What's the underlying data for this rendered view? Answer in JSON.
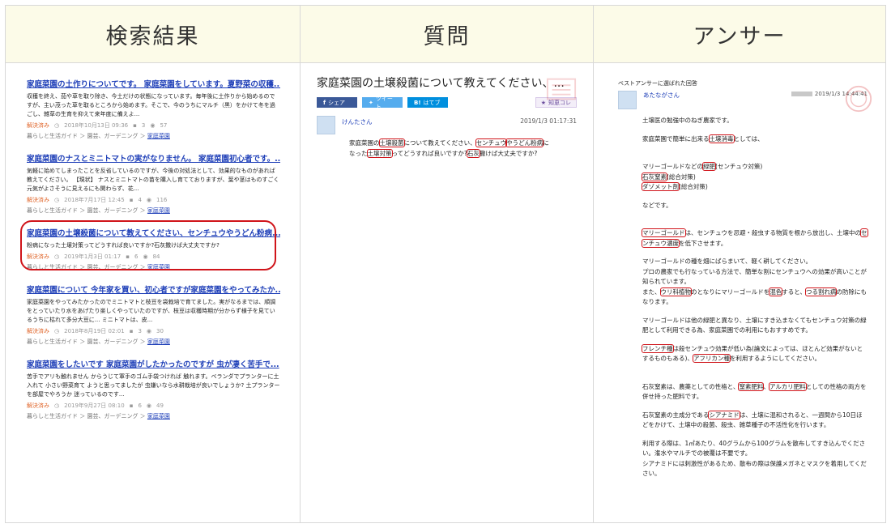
{
  "columns": {
    "search": "検索結果",
    "question": "質問",
    "answer": "アンサー"
  },
  "results": [
    {
      "title": "家庭菜園の土作りについてです。 家庭菜園をしています。夏野菜の収穫...",
      "snippet": "収穫を終え、茄や草を取り除き、今土だけの状態になっています。毎年後に土作りから始めるのですが、主い茂った草を取るところから始めます。そこで、今のうちにマルチ（黒）をかけて冬を過ごし、雑草の生育を抑えて来年度に備えよ...",
      "status": "解決済み",
      "date": "2018年10月13日 09:36",
      "answers": "3",
      "views": "57",
      "category": "暮らしと生活ガイド ＞ 園芸、ガーデニング ＞ ",
      "category_link": "家庭菜園"
    },
    {
      "title": "家庭菜園のナスとミニトマトの実がなりません。 家庭菜園初心者です。...",
      "snippet": "気軽に始めてしまったことを反省しているのですが、今後の対処法として、効果的なものがあれば教えてください。 【現状】 ナスとミニトマトの苗を購入し育てておりますが、葉や茎はものすごく元気がよさそうに見えるにも関わらず、花...",
      "status": "解決済み",
      "date": "2018年7月17日 12:45",
      "answers": "4",
      "views": "116",
      "category": "暮らしと生活ガイド ＞ 園芸、ガーデニング ＞ ",
      "category_link": "家庭菜園"
    },
    {
      "title": "家庭菜園の土壌殺菌について教えてください、センチュウやうどん粉病...",
      "snippet": "粉病になった土壌対策ってどうすれば良いですか?石灰撒けば大丈夫ですか?",
      "status": "解決済み",
      "date": "2019年1月3日 01:17",
      "answers": "6",
      "views": "84",
      "category": "暮らしと生活ガイド ＞ 園芸、ガーデニング ＞ ",
      "category_link": "家庭菜園"
    },
    {
      "title": "家庭菜園について 今年家を買い、初心者ですが家庭菜園をやってみたか...",
      "snippet": "家庭菜園をやってみたかったのでミニトマトと枝豆を袋栽培で育てました。実がなるまでは、順調をとっていたり水をあげたり楽しくやっていたのですが、枝豆は収穫時期が分からず様子を見ているうちに枯れて多分大豆に... ミニトマトは、皮...",
      "status": "解決済み",
      "date": "2018年8月19日 02:01",
      "answers": "3",
      "views": "30",
      "category": "暮らしと生活ガイド ＞ 園芸、ガーデニング ＞ ",
      "category_link": "家庭菜園"
    },
    {
      "title": "家庭菜園をしたいです 家庭菜園がしたかったのですが 虫が凄く苦手で...",
      "snippet": "苦手でアリも触れません からうじて軍手のゴム手袋つければ 触れます。ベランダでプランターに土入れて 小さい野菜育て ようと思ってましたが 虫嫌いなら水耕栽培が良いでしょうか? 土プランターを部屋でやろうか 迷っているのです...",
      "status": "解決済み",
      "date": "2019年9月27日 08:10",
      "answers": "6",
      "views": "49",
      "category": "暮らしと生活ガイド ＞ 園芸、ガーデニング ＞ ",
      "category_link": "家庭菜園"
    }
  ],
  "question": {
    "title": "家庭菜園の土壌殺菌について教えてください、...",
    "share_facebook": "シェア",
    "share_twitter": "ツイート",
    "share_hatena": "はてブ",
    "knowledge": "知恵コレ",
    "user": "けんたさん",
    "date": "2019/1/3 01:17:31",
    "body_1": "家庭菜園の",
    "hl_1": "土壌殺菌",
    "body_2": "について教えてください、",
    "hl_2": "センチュウ",
    "body_3": "やうどん粉病",
    "body_4": "に",
    "body_5": "なった",
    "hl_3": "土壌対策",
    "body_6": "ってどうすれば良いですか?",
    "hl_4": "石灰",
    "body_7": "撒けば大丈夫ですか?"
  },
  "answer": {
    "label": "ベストアンサーに選ばれた回答",
    "user": "あたながさん",
    "date": "2019/1/3 14:44:41",
    "p1": "土壌医の勉強中のねぎ農家です。",
    "p2a": "家庭菜園で簡単に出来る",
    "p2h": "土壌消毒",
    "p2b": "としては、",
    "p3a": "マリーゴールドなどの",
    "p3h": "緑肥",
    "p3b": "(センチュウ対策)",
    "p4h": "石灰窒素",
    "p4b": "(総合対策)",
    "p5h": "ダゾメット剤",
    "p5b": "(総合対策)",
    "p6": "などです。",
    "p7h": "マリーゴールド",
    "p7a": "は、センチュウを忌避・殺虫する物質を根から放出し、土壌中の",
    "p7h2": "センチュウ濃度",
    "p7b": "を低下させます。",
    "p8": "マリーゴールドの種を畑にばらまいて、軽く耕してください。",
    "p9": "プロの農家でも行なっている方法で、簡単な割にセンチュウへの効果が高いことが知られています。",
    "p10a": "また、",
    "p10h": "ウリ科植物",
    "p10b": "のとなりにマリーゴールドを",
    "p10h2": "混色",
    "p10c": "すると、",
    "p10h3": "つる割れ病",
    "p10d": "の防除にもなります。",
    "p11": "マリーゴールドは他の緑肥と異なり、土壌にすき込まなくてもセンチュウ対策の緑肥として利用できる為、家庭菜園での利用にもおすすめです。",
    "p12h": "フレンチ種",
    "p12a": "は殺センチュウ効果が低い為(論文によっては、ほとんど効果がないとするものもある)、",
    "p12h2": "アフリカン種",
    "p12b": "を利用するようにしてください。",
    "p13a": "石灰窒素は、農薬としての性格と、",
    "p13h": "窒素肥料",
    "p13b": "、",
    "p13h2": "アルカリ肥料",
    "p13c": "としての性格の両方を併せ持った肥料です。",
    "p14a": "石灰窒素の主成分である",
    "p14h": "シアナミド",
    "p14b": "は、土壌に混和されると、一週間から10日ほどをかけて、土壌中の殺菌、殺虫、雑草種子の不活性化を行います。",
    "p15": "利用する際は、1㎡あたり、40グラムから100グラムを散布してすき込んでください。潅水やマルチでの被覆は不要です。",
    "p16": "シアナミドには刺激性があるため、散布の際は保護メガネとマスクを着用してください。"
  },
  "colors": {
    "header_bg": "#fcfbe8",
    "link": "#1e3fb8",
    "highlight": "#d0141a",
    "solved": "#e0662b"
  }
}
